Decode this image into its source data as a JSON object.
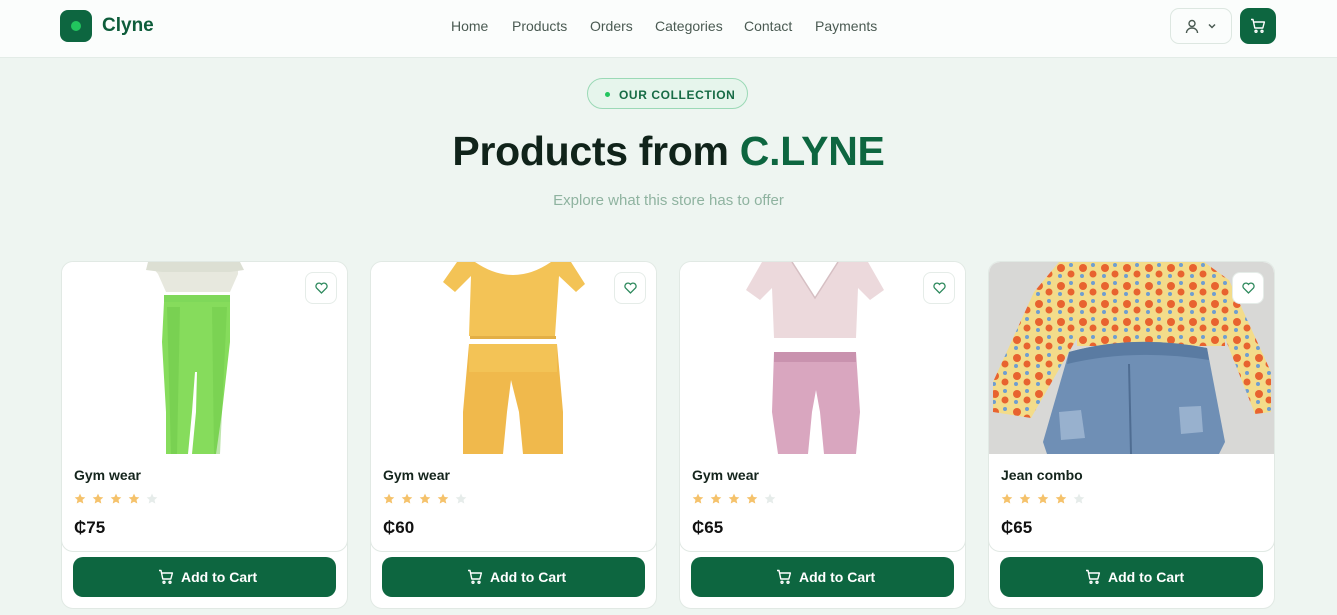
{
  "brand": {
    "name": "Clyne"
  },
  "nav": {
    "items": [
      "Home",
      "Products",
      "Orders",
      "Categories",
      "Contact",
      "Payments"
    ]
  },
  "header": {
    "user_icon": "user-icon",
    "cart_icon": "cart-icon"
  },
  "hero": {
    "badge": "OUR COLLECTION",
    "title_main": "Products from",
    "title_accent": "C.LYNE",
    "subtitle": "Explore what this store has to offer"
  },
  "colors": {
    "primary": "#0d6640",
    "accent_green": "#22c55e",
    "star": "#f5c26b",
    "star_empty": "#e6ecea",
    "background": "#eef5f1"
  },
  "products": [
    {
      "name": "Gym wear",
      "rating": 4,
      "max_rating": 5,
      "price": "₵75",
      "cta": "Add to Cart"
    },
    {
      "name": "Gym wear",
      "rating": 4,
      "max_rating": 5,
      "price": "₵60",
      "cta": "Add to Cart"
    },
    {
      "name": "Gym wear",
      "rating": 4,
      "max_rating": 5,
      "price": "₵65",
      "cta": "Add to Cart"
    },
    {
      "name": "Jean combo",
      "rating": 4,
      "max_rating": 5,
      "price": "₵65",
      "cta": "Add to Cart"
    }
  ]
}
